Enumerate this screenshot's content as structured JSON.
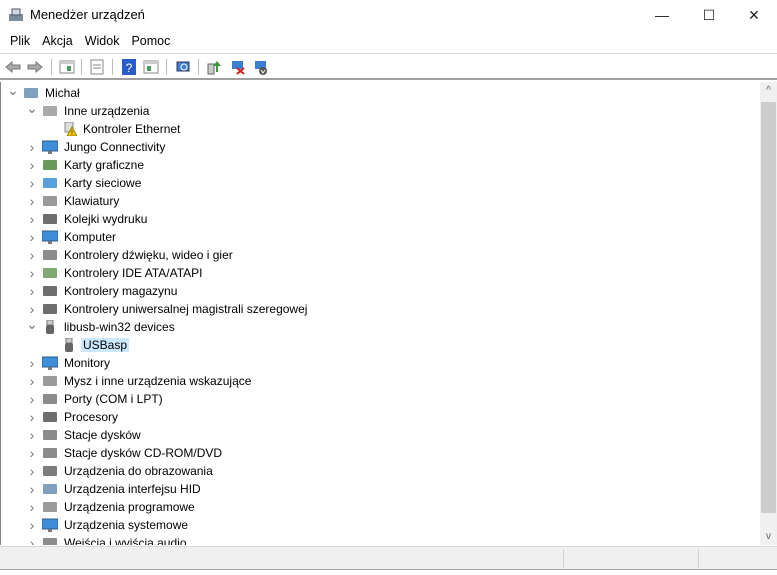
{
  "window": {
    "title": "Menedżer urządzeń",
    "minimize": "—",
    "maximize": "☐",
    "close": "✕"
  },
  "menu": [
    "Plik",
    "Akcja",
    "Widok",
    "Pomoc"
  ],
  "toolbar": [
    "back",
    "forward",
    "show-hide-console-tree",
    "properties",
    "help",
    "show-hide-action-pane",
    "scan-hardware",
    "update-driver",
    "uninstall-device",
    "disable-device"
  ],
  "tree": [
    {
      "level": 0,
      "label": "Michał",
      "expanded": true,
      "icon": "computer-icon",
      "color": "#6a8fb5"
    },
    {
      "level": 1,
      "label": "Inne urządzenia",
      "expanded": true,
      "icon": "unknown-device-icon",
      "color": "#9a9a9a"
    },
    {
      "level": 2,
      "label": "Kontroler Ethernet",
      "icon": "warning-device-icon",
      "color": "#e8c400"
    },
    {
      "level": 1,
      "label": "Jungo Connectivity",
      "expanded": false,
      "icon": "monitor-icon",
      "color": "#3c8fd8"
    },
    {
      "level": 1,
      "label": "Karty graficzne",
      "expanded": false,
      "icon": "display-adapter-icon",
      "color": "#4e8a3e"
    },
    {
      "level": 1,
      "label": "Karty sieciowe",
      "expanded": false,
      "icon": "network-adapter-icon",
      "color": "#3c8fd8"
    },
    {
      "level": 1,
      "label": "Klawiatury",
      "expanded": false,
      "icon": "keyboard-icon",
      "color": "#888888"
    },
    {
      "level": 1,
      "label": "Kolejki wydruku",
      "expanded": false,
      "icon": "printer-icon",
      "color": "#555555"
    },
    {
      "level": 1,
      "label": "Komputer",
      "expanded": false,
      "icon": "monitor-icon",
      "color": "#3c8fd8"
    },
    {
      "level": 1,
      "label": "Kontrolery dźwięku, wideo i gier",
      "expanded": false,
      "icon": "speaker-icon",
      "color": "#777777"
    },
    {
      "level": 1,
      "label": "Kontrolery IDE ATA/ATAPI",
      "expanded": false,
      "icon": "ide-icon",
      "color": "#6a9a5a"
    },
    {
      "level": 1,
      "label": "Kontrolery magazynu",
      "expanded": false,
      "icon": "storage-icon",
      "color": "#555555"
    },
    {
      "level": 1,
      "label": "Kontrolery uniwersalnej magistrali szeregowej",
      "expanded": false,
      "icon": "usb-icon",
      "color": "#555555"
    },
    {
      "level": 1,
      "label": "libusb-win32 devices",
      "expanded": true,
      "icon": "usb-plug-icon",
      "color": "#666666"
    },
    {
      "level": 2,
      "label": "USBasp",
      "icon": "usb-plug-icon",
      "color": "#666666",
      "selected": true
    },
    {
      "level": 1,
      "label": "Monitory",
      "expanded": false,
      "icon": "monitor-icon",
      "color": "#3c8fd8"
    },
    {
      "level": 1,
      "label": "Mysz i inne urządzenia wskazujące",
      "expanded": false,
      "icon": "mouse-icon",
      "color": "#888888"
    },
    {
      "level": 1,
      "label": "Porty (COM i LPT)",
      "expanded": false,
      "icon": "port-icon",
      "color": "#777777"
    },
    {
      "level": 1,
      "label": "Procesory",
      "expanded": false,
      "icon": "cpu-icon",
      "color": "#555555"
    },
    {
      "level": 1,
      "label": "Stacje dysków",
      "expanded": false,
      "icon": "disk-drive-icon",
      "color": "#777777"
    },
    {
      "level": 1,
      "label": "Stacje dysków CD-ROM/DVD",
      "expanded": false,
      "icon": "dvd-drive-icon",
      "color": "#777777"
    },
    {
      "level": 1,
      "label": "Urządzenia do obrazowania",
      "expanded": false,
      "icon": "camera-icon",
      "color": "#666666"
    },
    {
      "level": 1,
      "label": "Urządzenia interfejsu HID",
      "expanded": false,
      "icon": "hid-icon",
      "color": "#6a8fb5"
    },
    {
      "level": 1,
      "label": "Urządzenia programowe",
      "expanded": false,
      "icon": "software-device-icon",
      "color": "#888888"
    },
    {
      "level": 1,
      "label": "Urządzenia systemowe",
      "expanded": false,
      "icon": "monitor-icon",
      "color": "#3c8fd8"
    },
    {
      "level": 1,
      "label": "Wejścia i wyjścia audio",
      "expanded": false,
      "icon": "speaker-icon",
      "color": "#777777"
    }
  ],
  "scrollbar": {
    "up": "^",
    "down": "v"
  }
}
